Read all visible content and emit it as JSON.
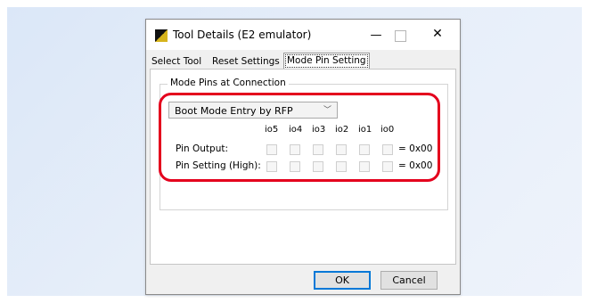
{
  "window": {
    "title": "Tool Details (E2 emulator)"
  },
  "tabs": [
    {
      "label": "Select Tool"
    },
    {
      "label": "Reset Settings"
    },
    {
      "label": "Mode Pin Setting",
      "selected": true
    }
  ],
  "group": {
    "label": "Mode Pins at Connection"
  },
  "combo": {
    "value": "Boot Mode Entry by RFP"
  },
  "pins": {
    "headers": [
      "io5",
      "io4",
      "io3",
      "io2",
      "io1",
      "io0"
    ]
  },
  "rows": [
    {
      "label": "Pin Output:",
      "value": "= 0x00"
    },
    {
      "label": "Pin Setting (High):",
      "value": "= 0x00"
    }
  ],
  "buttons": {
    "ok": "OK",
    "cancel": "Cancel"
  },
  "colors": {
    "highlight": "#e4001d",
    "background": "#e3ecf9"
  }
}
